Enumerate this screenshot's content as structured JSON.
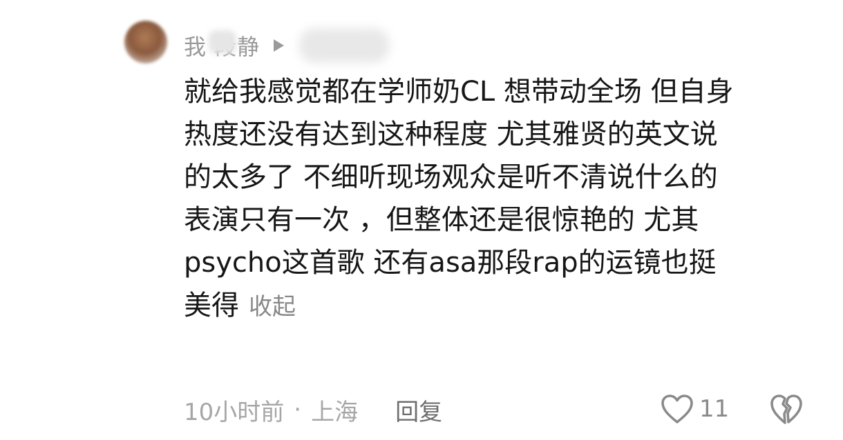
{
  "comment": {
    "username": "我  段静",
    "lines": [
      "就给我感觉都在学师奶CL 想带动全场 但自身",
      "热度还没有达到这种程度 尤其雅贤的英文说",
      "的太多了 不细听现场观众是听不清说什么的",
      "表演只有一次 ，但整体还是很惊艳的 尤其",
      "psycho这首歌 还有asa那段rap的运镜也挺",
      "美得"
    ],
    "collapse_label": "收起"
  },
  "meta": {
    "time": "10小时前",
    "separator": "·",
    "location": "上海",
    "reply_label": "回复"
  },
  "reactions": {
    "like_count": "11",
    "like_icon": "heart-outline-icon",
    "dislike_icon": "broken-heart-icon"
  },
  "colors": {
    "text": "#161616",
    "muted": "#a6a6a6",
    "icon": "#8a8a8a"
  }
}
